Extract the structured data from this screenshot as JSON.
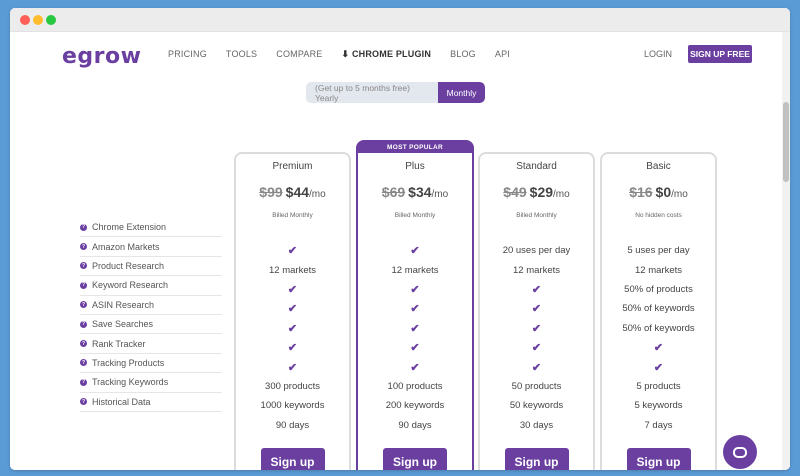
{
  "brand": {
    "logo": "egrow",
    "accent": "#6b3fa0"
  },
  "nav": {
    "items": [
      "PRICING",
      "TOOLS",
      "COMPARE",
      "⬇ CHROME PLUGIN",
      "BLOG",
      "API"
    ],
    "login": "LOGIN",
    "signup": "SIGN UP FREE"
  },
  "billing_toggle": {
    "yearly": "(Get up to 5 months free) Yearly",
    "monthly": "Monthly",
    "selected": "Monthly"
  },
  "features": [
    "Chrome Extension",
    "Amazon Markets",
    "Product Research",
    "Keyword Research",
    "ASIN Research",
    "Save Searches",
    "Rank Tracker",
    "Tracking Products",
    "Tracking Keywords",
    "Historical Data"
  ],
  "plans": [
    {
      "name": "Premium",
      "old_price": "$99",
      "price": "$44",
      "per": "/mo",
      "billing": "Billed Monthly",
      "badge": "",
      "values": [
        "✔",
        "12 markets",
        "✔",
        "✔",
        "✔",
        "✔",
        "✔",
        "300 products",
        "1000 keywords",
        "90 days"
      ],
      "button": "Sign up"
    },
    {
      "name": "Plus",
      "old_price": "$69",
      "price": "$34",
      "per": "/mo",
      "billing": "Billed Monthly",
      "badge": "MOST POPULAR",
      "values": [
        "✔",
        "12 markets",
        "✔",
        "✔",
        "✔",
        "✔",
        "✔",
        "100 products",
        "200 keywords",
        "90 days"
      ],
      "button": "Sign up"
    },
    {
      "name": "Standard",
      "old_price": "$49",
      "price": "$29",
      "per": "/mo",
      "billing": "Billed Monthly",
      "badge": "",
      "values": [
        "20 uses per day",
        "12 markets",
        "✔",
        "✔",
        "✔",
        "✔",
        "✔",
        "50 products",
        "50 keywords",
        "30 days"
      ],
      "button": "Sign up"
    },
    {
      "name": "Basic",
      "old_price": "$16",
      "price": "$0",
      "per": "/mo",
      "billing": "No hidden costs",
      "badge": "",
      "values": [
        "5 uses per day",
        "12 markets",
        "50% of products",
        "50% of keywords",
        "50% of keywords",
        "✔",
        "✔",
        "5 products",
        "5 keywords",
        "7 days"
      ],
      "button": "Sign up"
    }
  ],
  "chat": {
    "icon": "chat-bubble-icon"
  }
}
